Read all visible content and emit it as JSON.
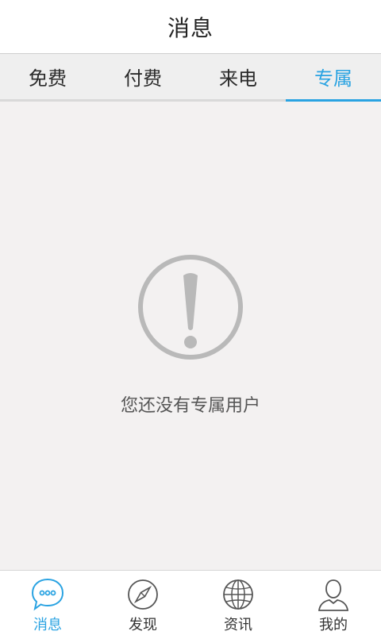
{
  "header": {
    "title": "消息"
  },
  "tabs": [
    {
      "label": "免费",
      "active": false
    },
    {
      "label": "付费",
      "active": false
    },
    {
      "label": "来电",
      "active": false
    },
    {
      "label": "专属",
      "active": true
    }
  ],
  "empty_state": {
    "icon": "warning-icon",
    "message": "您还没有专属用户"
  },
  "bottom_nav": [
    {
      "label": "消息",
      "icon": "chat-bubble-icon",
      "active": true
    },
    {
      "label": "发现",
      "icon": "compass-icon",
      "active": false
    },
    {
      "label": "资讯",
      "icon": "globe-icon",
      "active": false
    },
    {
      "label": "我的",
      "icon": "user-icon",
      "active": false
    }
  ],
  "colors": {
    "accent": "#2aa3e2",
    "background": "#f3f1f1",
    "icon_gray": "#b9b9b9"
  }
}
